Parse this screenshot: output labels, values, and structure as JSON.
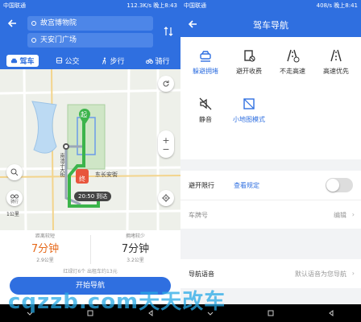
{
  "left": {
    "status": {
      "carrier": "中国联通",
      "speed": "112.3K/s",
      "time": "晚上8:43"
    },
    "from": "故宫博物院",
    "to": "天安门广场",
    "tabs": [
      {
        "label": "驾车",
        "icon": "car-icon",
        "active": true
      },
      {
        "label": "公交",
        "icon": "bus-icon",
        "active": false
      },
      {
        "label": "步行",
        "icon": "walk-icon",
        "active": false
      },
      {
        "label": "骑行",
        "icon": "bike-icon",
        "active": false
      }
    ],
    "map": {
      "start_marker": "起",
      "end_marker": "终",
      "street": "东长安街",
      "road_label": "南池子大街",
      "eta": "20:50 到达",
      "scale": "1公里",
      "bike_button": "骑行",
      "route_color": "#3cb44b",
      "accent_color": "#2f6fe0"
    },
    "routes": [
      {
        "tag": "距离较短",
        "duration": "7分钟",
        "distance": "2.9公里"
      },
      {
        "tag": "拥堵较少",
        "duration": "7分钟",
        "distance": "3.2公里"
      }
    ],
    "route_info": "红绿灯6个 出租车约13元",
    "start_button": "开始导航"
  },
  "right": {
    "status": {
      "carrier": "中国联通",
      "speed": "408/s",
      "time": "晚上8:41"
    },
    "title": "驾车导航",
    "prefs": [
      {
        "label": "躲避拥堵",
        "icon": "car-avoid-jam-icon",
        "active": true
      },
      {
        "label": "避开收费",
        "icon": "toll-avoid-icon",
        "active": false
      },
      {
        "label": "不走高速",
        "icon": "no-highway-icon",
        "active": false
      },
      {
        "label": "高速优先",
        "icon": "highway-first-icon",
        "active": false
      },
      {
        "label": "静音",
        "icon": "mute-icon",
        "active": false
      },
      {
        "label": "小地图模式",
        "icon": "mini-map-icon",
        "active": true
      }
    ],
    "restrict": {
      "label": "避开限行",
      "link": "查看规定",
      "enabled": false
    },
    "plate": {
      "label": "车牌号",
      "action": "编辑"
    },
    "voice": {
      "label": "导航语音",
      "value": "默认语音为您导航"
    }
  },
  "watermark": "cqzzb.com天天改车"
}
